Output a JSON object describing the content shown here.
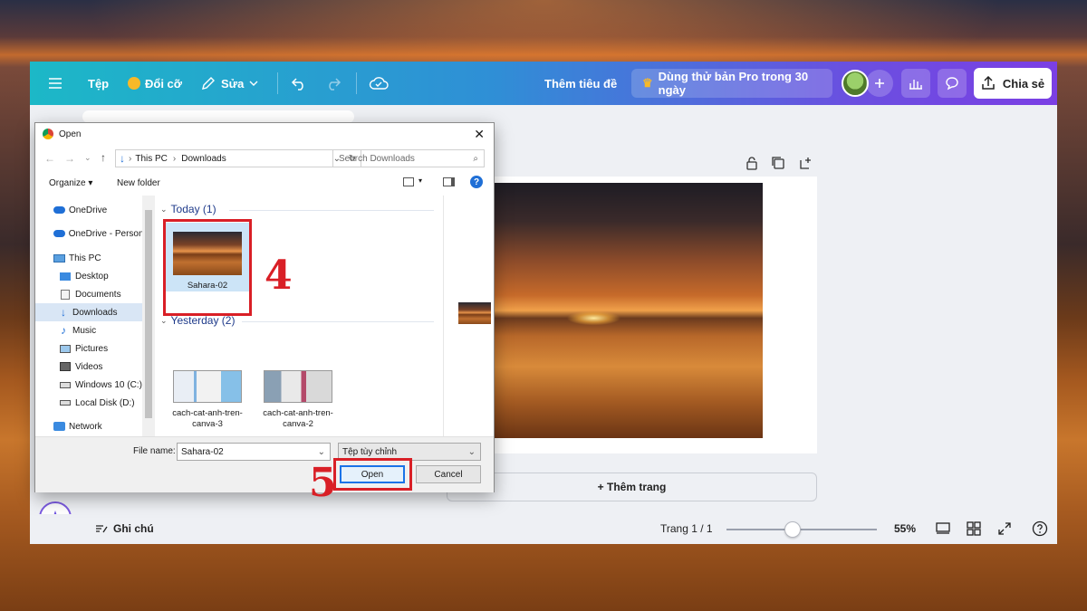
{
  "toolbar": {
    "file": "Tệp",
    "resize": "Đổi cỡ",
    "edit": "Sửa",
    "title": "Thêm tiêu đề",
    "pro": "Dùng thử bản Pro trong 30 ngày",
    "share": "Chia sẻ"
  },
  "canvas": {
    "add_page": "+ Thêm trang",
    "notes": "Ghi chú",
    "page_indicator": "Trang 1 / 1",
    "zoom": "55%"
  },
  "dialog": {
    "title": "Open",
    "breadcrumb": [
      "This PC",
      "Downloads"
    ],
    "search_placeholder": "Search Downloads",
    "organize": "Organize",
    "new_folder": "New folder",
    "nav": [
      "OneDrive",
      "OneDrive - Person",
      "This PC",
      "Desktop",
      "Documents",
      "Downloads",
      "Music",
      "Pictures",
      "Videos",
      "Windows 10 (C:)",
      "Local Disk (D:)",
      "Network"
    ],
    "groups": {
      "today": "Today (1)",
      "yesterday": "Yesterday (2)"
    },
    "files": {
      "sahara": "Sahara-02",
      "canva3": "cach-cat-anh-tren-canva-3",
      "canva2": "cach-cat-anh-tren-canva-2"
    },
    "file_name_label": "File name:",
    "file_name_value": "Sahara-02",
    "file_type": "Tệp tùy chỉnh",
    "open_button": "Open",
    "cancel_button": "Cancel"
  },
  "annotations": {
    "step4": "4",
    "step5": "5"
  },
  "colors": {
    "highlight": "#d91f26",
    "topbar_start": "#1cb8c7",
    "topbar_end": "#7b3fe4"
  }
}
